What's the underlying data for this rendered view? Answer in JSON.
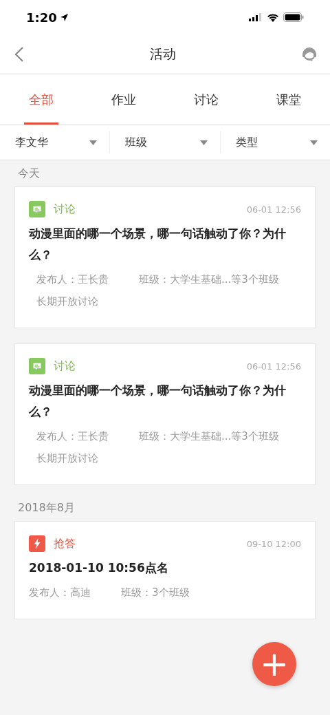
{
  "status_bar": {
    "time": "1:20"
  },
  "nav": {
    "title": "活动"
  },
  "tabs": [
    {
      "label": "全部",
      "selected": true
    },
    {
      "label": "作业",
      "selected": false
    },
    {
      "label": "讨论",
      "selected": false
    },
    {
      "label": "课堂",
      "selected": false
    }
  ],
  "filters": [
    {
      "label": "李文华"
    },
    {
      "label": "班级"
    },
    {
      "label": "类型"
    }
  ],
  "sections": [
    {
      "heading": "今天",
      "cards": [
        {
          "kind": "discussion",
          "type_label": "讨论",
          "time": "06-01 12:56",
          "title": "动漫里面的哪一个场景，哪一句话触动了你？为什么？",
          "publisher": "发布人：王长贵",
          "classes": "班级：大学生基础...等3个班级",
          "note": "长期开放讨论"
        },
        {
          "kind": "discussion",
          "type_label": "讨论",
          "time": "06-01 12:56",
          "title": "动漫里面的哪一个场景，哪一句话触动了你？为什么？",
          "publisher": "发布人：王长贵",
          "classes": "班级：大学生基础...等3个班级",
          "note": "长期开放讨论"
        }
      ]
    },
    {
      "heading": "2018年8月",
      "cards": [
        {
          "kind": "quiz",
          "type_label": "抢答",
          "time": "09-10 12:00",
          "title": "2018-01-10 10:56点名",
          "publisher": "发布人：高迪",
          "classes": "班级：3个班级"
        }
      ]
    }
  ],
  "fab": {
    "label": "+"
  }
}
